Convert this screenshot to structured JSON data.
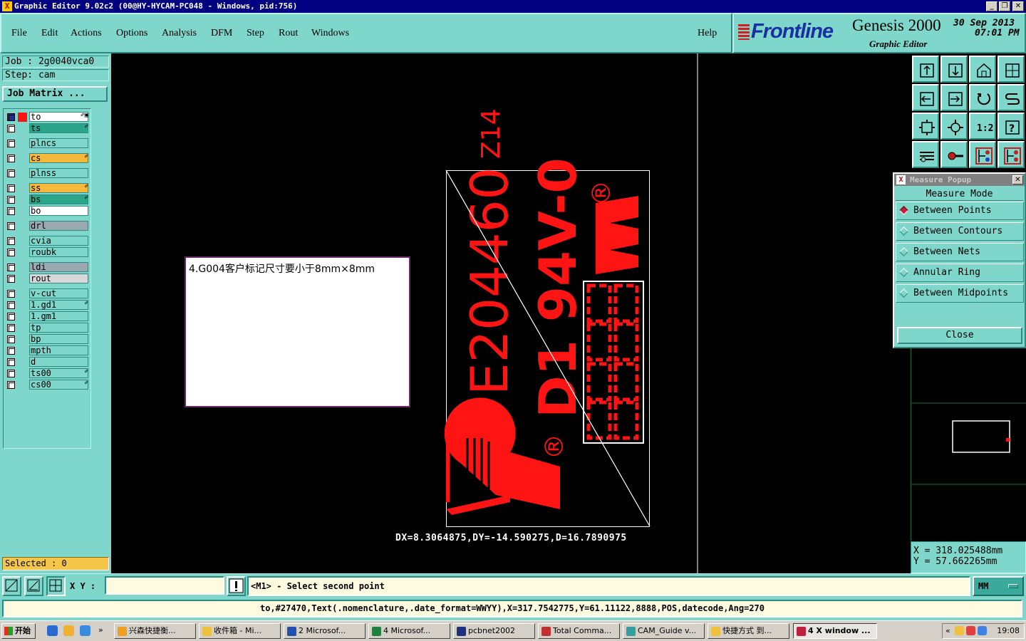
{
  "window": {
    "title": "Graphic Editor 9.02c2 (00@HY-HYCAM-PC048 - Windows, pid:756)",
    "controls": [
      "_",
      "❐",
      "✕"
    ]
  },
  "menu": [
    "File",
    "Edit",
    "Actions",
    "Options",
    "Analysis",
    "DFM",
    "Step",
    "Rout",
    "Windows"
  ],
  "help": "Help",
  "brand": {
    "logo": "Frontline",
    "product": "Genesis 2000",
    "subtitle": "Graphic Editor",
    "date": "30 Sep 2013",
    "time": "07:01 PM"
  },
  "job": {
    "job_line": "Job : 2g0040vca0",
    "step_line": "Step: cam",
    "matrix_button": "Job Matrix ..."
  },
  "layers": [
    {
      "name": "to",
      "color": "#ffffff",
      "mark": "✐▣"
    },
    {
      "name": "ts",
      "color": "#2aa58a",
      "mark": "✐"
    },
    {
      "name": "plncs",
      "color": "#7fd6cb",
      "mark": ""
    },
    {
      "name": "cs",
      "color": "#f5b83a",
      "mark": "✐"
    },
    {
      "name": "plnss",
      "color": "#7fd6cb",
      "mark": ""
    },
    {
      "name": "ss",
      "color": "#f5b83a",
      "mark": "✐"
    },
    {
      "name": "bs",
      "color": "#2aa58a",
      "mark": "✐"
    },
    {
      "name": "bo",
      "color": "#ffffff",
      "mark": ""
    },
    {
      "name": "drl",
      "color": "#9aa8b0",
      "mark": ""
    },
    {
      "name": "cvia",
      "color": "#7fd6cb",
      "mark": ""
    },
    {
      "name": "roubk",
      "color": "#7fd6cb",
      "mark": ""
    },
    {
      "name": "ldi",
      "color": "#9aa8b0",
      "mark": ""
    },
    {
      "name": "rout",
      "color": "#d8d8d8",
      "mark": ""
    },
    {
      "name": "v-cut",
      "color": "#7fd6cb",
      "mark": ""
    },
    {
      "name": "1.gd1",
      "color": "#7fd6cb",
      "mark": "✐"
    },
    {
      "name": "1.gm1",
      "color": "#7fd6cb",
      "mark": ""
    },
    {
      "name": "tp",
      "color": "#7fd6cb",
      "mark": ""
    },
    {
      "name": "bp",
      "color": "#7fd6cb",
      "mark": ""
    },
    {
      "name": "mpth",
      "color": "#7fd6cb",
      "mark": ""
    },
    {
      "name": "d",
      "color": "#7fd6cb",
      "mark": ""
    },
    {
      "name": "ts00",
      "color": "#7fd6cb",
      "mark": "✐"
    },
    {
      "name": "cs00",
      "color": "#7fd6cb",
      "mark": "✐"
    }
  ],
  "selected": "Selected : 0",
  "note": "4.G004客户标记尺寸要小于8mm×8mm",
  "board": {
    "text_main": "E204460",
    "text_side": "D1 94V-0",
    "text_top": "Z14",
    "registered": "®",
    "fill_color": "#ff1414"
  },
  "measure_readout": "DX=8.3064875,DY=-14.590275,D=16.7890975",
  "measure_popup": {
    "title": "Measure Popup",
    "header": "Measure Mode",
    "options": [
      "Between Points",
      "Between Contours",
      "Between Nets",
      "Annular Ring",
      "Between Midpoints"
    ],
    "selected_index": 0,
    "close": "Close"
  },
  "toolbox_icons": [
    "zoom-home-icon",
    "zoom-in-icon",
    "home-icon",
    "split-icon",
    "pan-left-icon",
    "pan-right-icon",
    "undo-zoom-icon",
    "redraw-icon",
    "fit-icon",
    "center-icon",
    "scale-icon",
    "query-icon",
    "tools-icon",
    "snap-icon",
    "net-icon",
    "net-color-icon"
  ],
  "coords": {
    "x": "X = 318.025488mm",
    "y": "Y = 57.662265mm"
  },
  "bottom": {
    "xy_label": "X Y :",
    "xy_value": "",
    "prompt": "<M1> - Select second point",
    "units": "MM"
  },
  "info_line": "to,#27470,Text(.nomenclature,.date_format=WWYY),X=317.7542775,Y=61.11122,8888,POS,datecode,Ang=270",
  "taskbar": {
    "start": "开始",
    "tasks": [
      "兴森快捷衡...",
      "收件箱 - Mi...",
      "2 Microsof...",
      "4 Microsof...",
      "pcbnet2002",
      "Total Comma...",
      "CAM_Guide v...",
      "快捷方式 到...",
      "4 X window ..."
    ],
    "clock": "19:08"
  }
}
